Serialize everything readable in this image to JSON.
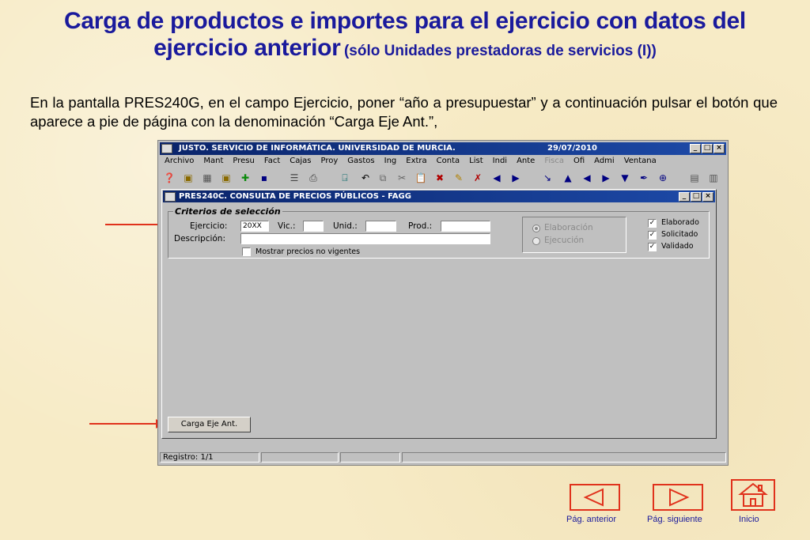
{
  "slide": {
    "title_line1": "Carga de productos e importes para el ejercicio con datos del",
    "title_line2_big": "ejercicio anterior",
    "title_line2_small": "(sólo Unidades prestadoras de servicios (I))",
    "intro": "En la pantalla PRES240G, en el campo Ejercicio, poner “año a presupuestar”  y a continuación pulsar el botón que  aparece a pie de página con la denominación “Carga Eje Ant.”,"
  },
  "app": {
    "title": "JUSTO. SERVICIO DE INFORMÁTICA. UNIVERSIDAD DE MURCIA.",
    "date": "29/07/2010",
    "menu": [
      "Archivo",
      "Mant",
      "Presu",
      "Fact",
      "Cajas",
      "Proy",
      "Gastos",
      "Ing",
      "Extra",
      "Conta",
      "List",
      "Indi",
      "Ante",
      "Fisca",
      "Ofi",
      "Admi",
      "Ventana"
    ],
    "window_buttons": {
      "minimize": "_",
      "maximize": "□",
      "close": "×"
    }
  },
  "form": {
    "title": "PRES240C. CONSULTA DE PRECIOS PÚBLICOS - FAGG",
    "group_label": "Criterios de selección",
    "ejercicio_label": "Ejercicio:",
    "ejercicio_value": "20XX",
    "vic_label": "Vic.:",
    "unid_label": "Unid.:",
    "prod_label": "Prod.:",
    "descripcion_label": "Descripción:",
    "mostrar_label": "Mostrar precios no vigentes",
    "radio_elaboracion": "Elaboración",
    "radio_ejecucion": "Ejecución",
    "chk_elaborado": "Elaborado",
    "chk_solicitado": "Solicitado",
    "chk_validado": "Validado",
    "check_mark": "✓",
    "carga_button": "Carga Eje Ant."
  },
  "status": {
    "registro": "Registro: 1/1"
  },
  "nav": {
    "prev": "Pág. anterior",
    "next": "Pág. siguiente",
    "home": "Inicio"
  },
  "colors": {
    "title": "#1a1a9c",
    "arrow": "#e0321c",
    "titlebar": "#0a246a"
  }
}
